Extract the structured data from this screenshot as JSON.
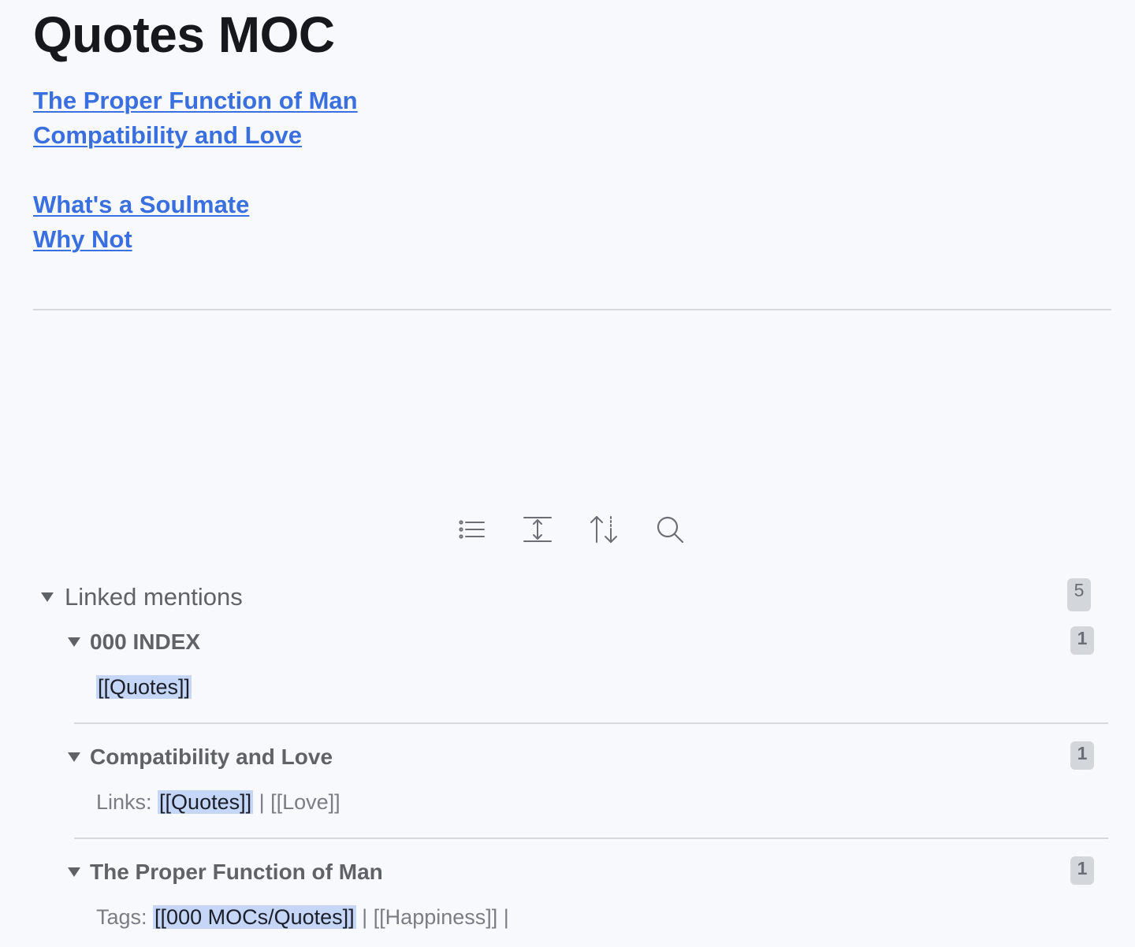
{
  "note": {
    "title": "Quotes MOC",
    "links": [
      "The Proper Function of Man",
      "Compatibility and Love",
      "What's a Soulmate",
      "Why Not"
    ]
  },
  "toolbar": {
    "icons": [
      "list-icon",
      "expand-icon",
      "sort-icon",
      "search-icon"
    ]
  },
  "backlinks": {
    "section_title": "Linked mentions",
    "total_count": "5",
    "files": [
      {
        "name": "000 INDEX",
        "count": "1",
        "snippet_prefix": "",
        "highlight": "[[Quotes]]",
        "snippet_suffix": ""
      },
      {
        "name": "Compatibility and Love",
        "count": "1",
        "snippet_prefix": "Links: ",
        "highlight": "[[Quotes]]",
        "snippet_suffix": " | [[Love]]"
      },
      {
        "name": "The Proper Function of Man",
        "count": "1",
        "snippet_prefix": "Tags: ",
        "highlight": "[[000 MOCs/Quotes]]",
        "snippet_suffix": " | [[Happiness]] |"
      }
    ]
  },
  "colors": {
    "background": "#f7f9fd",
    "link": "#3a6fe0",
    "highlight": "#c5d6f7",
    "muted_text": "#5f6368"
  }
}
